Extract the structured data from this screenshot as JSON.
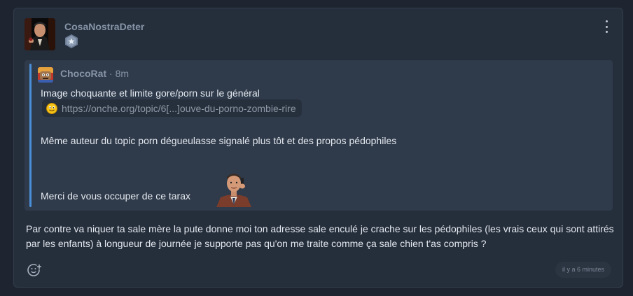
{
  "post": {
    "author": "CosaNostraDeter",
    "avatar_icon": "godfather-avatar",
    "rank_icon": "star-hexagon-badge-icon",
    "menu_icon": "kebab-menu-icon",
    "quote": {
      "author": "ChocoRat",
      "separator": " · ",
      "time": "8m",
      "avatar_icon": "chocorat-avatar",
      "line1": "Image choquante et limite gore/porn sur le général",
      "link_text": "https://onche.org/topic/6[...]ouve-du-porno-zombie-rire",
      "link_icon": "onche-smiley-icon",
      "line2": "Même auteur du topic porn dégueulasse signalé plus tôt et des propos pédophiles",
      "line3": "Merci de vous occuper de ce tarax",
      "sticker_icon": "phone-man-sticker"
    },
    "body": "Par contre va niquer ta sale mère la pute donne moi ton adresse sale enculé je crache sur les pédophiles (les vrais ceux qui sont attirés par les enfants) à longueur de journée je supporte pas qu'on me traite comme ça sale chien t'as compris ?",
    "react_icon": "add-reaction-icon",
    "timestamp": "il y a 6 minutes"
  },
  "colors": {
    "page_bg": "#1e2530",
    "card_bg": "#252e3b",
    "quote_bg": "#2f3a4a",
    "quote_bar": "#4a90d9",
    "author": "#8795a8"
  }
}
